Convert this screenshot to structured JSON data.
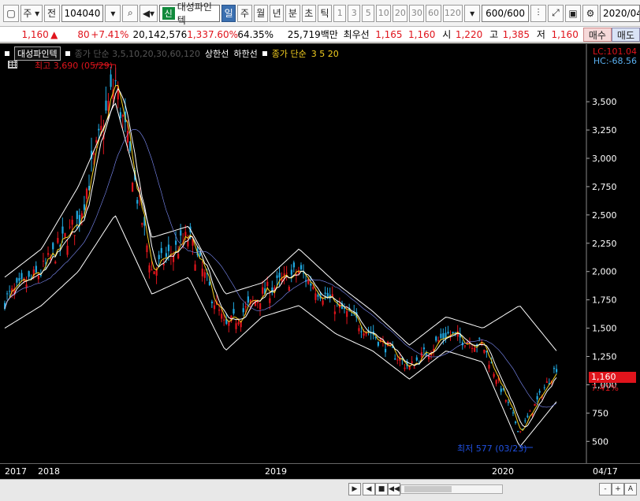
{
  "toolbar": {
    "market": "주",
    "view_label": "전",
    "code": "104040",
    "name_tag": "신",
    "stock_name": "대성파인텍",
    "periods": [
      "일",
      "주",
      "월",
      "년",
      "분",
      "초",
      "틱"
    ],
    "active_period": "일",
    "intervals": [
      "1",
      "3",
      "5",
      "10",
      "20",
      "30",
      "60",
      "120"
    ],
    "count": "600",
    "count_total": "/600",
    "date": "2020/04/1"
  },
  "quote": {
    "price": "1,160",
    "change_arrow": "▲",
    "change": "80",
    "change_pct": "+7.41%",
    "volume": "20,142,576",
    "volume_pct": "1,337.60%",
    "turnover": "64.35%",
    "amount": "25,719백만",
    "best_ask_label": "최우선",
    "best_ask": "1,165",
    "best_bid": "1,160",
    "open_label": "시",
    "open": "1,220",
    "high_label": "고",
    "high": "1,385",
    "low_label": "저",
    "low": "1,160",
    "buy_label": "매수",
    "sell_label": "매도"
  },
  "legend": {
    "stock": "대성파인텍",
    "hidden_mas": "종가 단순 3,5,10,20,30,60,120",
    "upper": "상한선",
    "lower": "하한선",
    "ma_label": "종가 단순",
    "ma_periods": "3  5  20"
  },
  "annotations": {
    "high": "최고 3,690 (05/29)",
    "low": "최저 577 (03/23)",
    "lc": "LC:101.04",
    "hc": "HC:-68.56",
    "last_price": "1,160",
    "last_pct": "7.41%"
  },
  "chart_data": {
    "type": "candlestick",
    "title": "",
    "x_labels": [
      "2017",
      "2018",
      "2019",
      "2020",
      "04/17"
    ],
    "y_ticks": [
      "3,500",
      "3,250",
      "3,000",
      "2,750",
      "2,500",
      "2,250",
      "2,000",
      "1,750",
      "1,500",
      "1,250",
      "1,000",
      "750",
      "500"
    ],
    "ylim": [
      500,
      3800
    ],
    "x": [
      "2017-11",
      "2018-01",
      "2018-03",
      "2018-05",
      "2018-07",
      "2018-09",
      "2018-11",
      "2019-01",
      "2019-03",
      "2019-05",
      "2019-07",
      "2019-09",
      "2019-11",
      "2020-01",
      "2020-03",
      "2020-04"
    ],
    "series": [
      {
        "name": "",
        "values": [
          1750,
          2000,
          2450,
          3690,
          2000,
          2300,
          1500,
          1800,
          2000,
          1700,
          1450,
          1150,
          1450,
          1350,
          580,
          1160
        ]
      }
    ],
    "bands": {
      "upper": [
        1950,
        2200,
        2750,
        3500,
        2300,
        2400,
        1800,
        1900,
        2200,
        1900,
        1650,
        1350,
        1600,
        1500,
        1700,
        1300
      ],
      "lower": [
        1500,
        1700,
        2000,
        2500,
        1800,
        1950,
        1300,
        1600,
        1700,
        1450,
        1300,
        1050,
        1300,
        1200,
        450,
        850
      ]
    },
    "grid": false,
    "legend_position": "top-left"
  },
  "colors": {
    "up": "#e0141c",
    "down": "#20a8e0",
    "ma3": "#f5d020",
    "ma5": "#ffffff",
    "ma20": "#8090ff",
    "band": "#ffffff"
  },
  "bottom": {
    "nav": [
      "▶",
      "◀",
      "■",
      "◀◀",
      "-",
      "+",
      "A"
    ]
  }
}
